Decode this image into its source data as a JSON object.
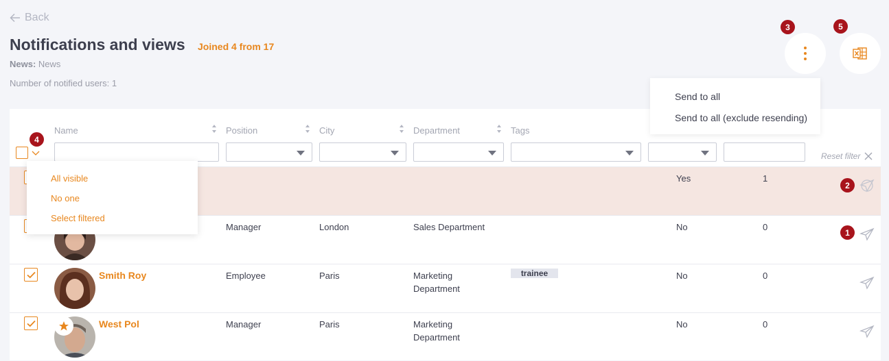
{
  "header": {
    "back_label": "Back",
    "title": "Notifications and views",
    "joined": "Joined 4 from 17",
    "news_label": "News:",
    "news_value": "News",
    "notified": "Number of notified users: 1"
  },
  "badges": {
    "b1": "1",
    "b2": "2",
    "b3": "3",
    "b4": "4",
    "b5": "5"
  },
  "actions_menu": {
    "items": [
      "Send to all",
      "Send to all (exclude resending)"
    ]
  },
  "select_menu": {
    "items": [
      "All visible",
      "No one",
      "Select filtered"
    ]
  },
  "table": {
    "columns": [
      "Name",
      "Position",
      "City",
      "Department",
      "Tags"
    ],
    "reset_filter": "Reset filter",
    "rows": [
      {
        "name": "",
        "position": "",
        "city": "",
        "department": "",
        "tag": "",
        "viewed": "Yes",
        "count": "1",
        "checked": true
      },
      {
        "name": "",
        "position": "Manager",
        "city": "London",
        "department": "Sales Department",
        "tag": "",
        "viewed": "No",
        "count": "0",
        "checked": true
      },
      {
        "name": "Smith Roy",
        "position": "Employee",
        "city": "Paris",
        "department_l1": "Marketing",
        "department_l2": "Department",
        "tag": "trainee",
        "viewed": "No",
        "count": "0",
        "checked": true
      },
      {
        "name": "West Pol",
        "position": "Manager",
        "city": "Paris",
        "department_l1": "Marketing",
        "department_l2": "Department",
        "tag": "",
        "viewed": "No",
        "count": "0",
        "checked": true
      }
    ]
  },
  "colors": {
    "accent": "#e8871e",
    "badge": "#a8141c",
    "highlight_row": "#f5e6e1",
    "background": "#f4f5f9"
  }
}
